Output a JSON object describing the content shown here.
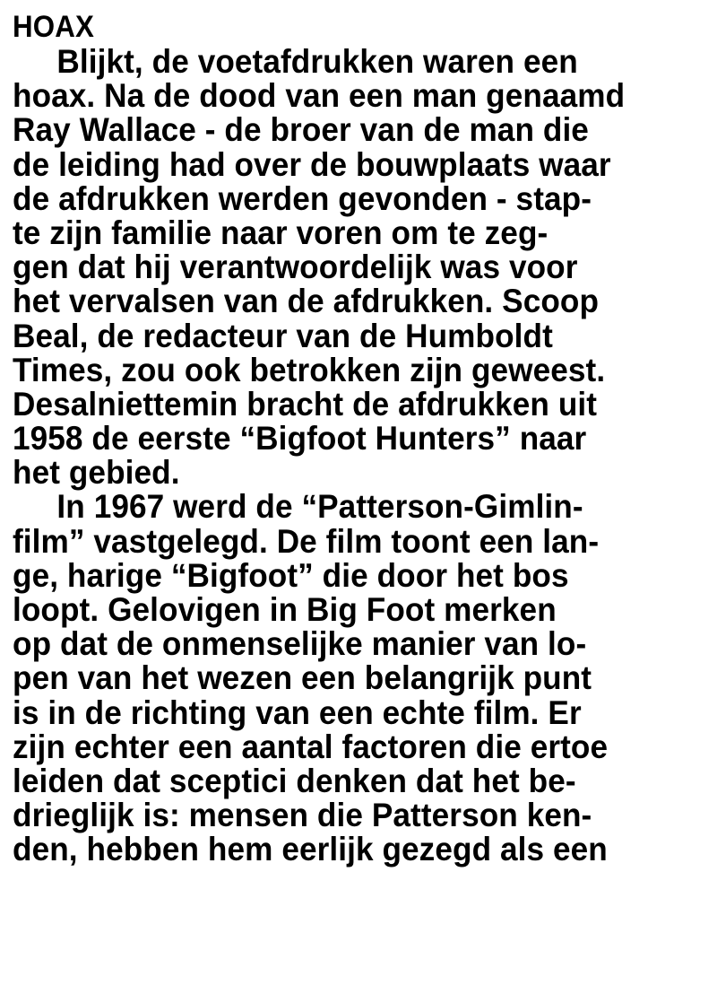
{
  "article": {
    "heading": "HOAX",
    "paragraphs": [
      {
        "lines": [
          "Blijkt, de voetafdrukken waren een",
          "hoax. Na de dood van een man genaamd",
          "Ray Wallace - de broer van de man die",
          "de leiding had over de bouwplaats waar",
          "de afdrukken werden gevonden - stap-",
          "te zijn familie naar voren om te zeg-",
          "gen dat hij verantwoordelijk was voor",
          "het vervalsen van de afdrukken. Scoop",
          "Beal, de redacteur van de Humboldt",
          "Times, zou ook betrokken zijn geweest.",
          "Desalniettemin bracht de afdrukken uit",
          "1958 de eerste “Bigfoot Hunters” naar",
          "het gebied."
        ]
      },
      {
        "lines": [
          "In 1967 werd de “Patterson-Gimlin-",
          "film” vastgelegd. De film toont een lan-",
          "ge, harige “Bigfoot” die door het bos",
          "loopt. Gelovigen in Big Foot merken",
          "op dat de onmenselijke manier van lo-",
          "pen van het wezen een belangrijk punt",
          "is in de richting van een echte film. Er",
          "zijn echter een aantal factoren die ertoe",
          "leiden dat sceptici denken dat het be-",
          "drieglijk is: mensen die Patterson ken-",
          "den, hebben hem eerlijk gezegd als een"
        ]
      }
    ]
  }
}
